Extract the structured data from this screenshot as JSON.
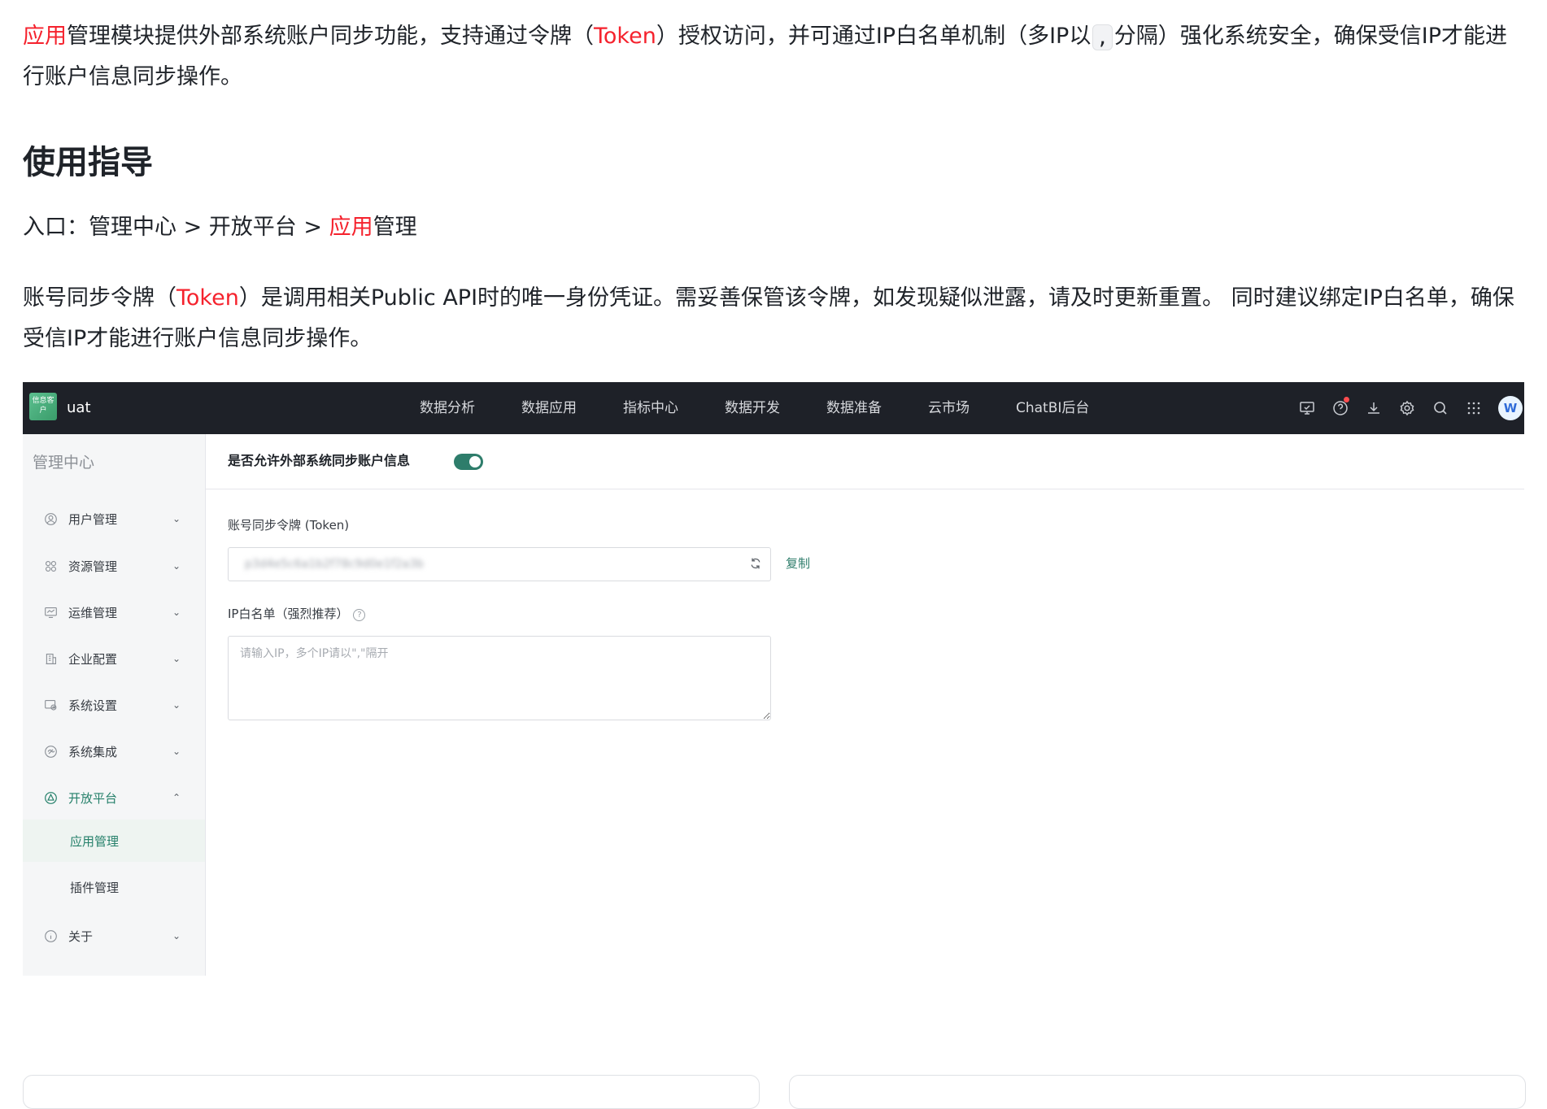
{
  "doc": {
    "intro": {
      "part1_red": "应用",
      "part2": "管理模块提供外部系统账户同步功能，支持通过令牌（",
      "part3_red": "Token",
      "part4": "）授权访问，并可通过IP白名单机制（多IP以",
      "code": ",",
      "part5": "分隔）强化系统安全，确保受信IP才能进行账户信息同步操作。"
    },
    "heading": "使用指导",
    "entry": {
      "prefix": "入口：管理中心 > 开放平台 > ",
      "red": "应用",
      "suffix": "管理"
    },
    "token_para": {
      "part1": "账号同步令牌（",
      "red": "Token",
      "part2": "）是调用相关Public API时的唯一身份凭证。需妥善保管该令牌，如发现疑似泄露，请及时更新重置。 同时建议绑定IP白名单，确保受信IP才能进行账户信息同步操作。"
    }
  },
  "screenshot": {
    "brand": "uat",
    "logo_text": "信息客户",
    "nav": [
      "数据分析",
      "数据应用",
      "指标中心",
      "数据开发",
      "数据准备",
      "云市场",
      "ChatBI后台"
    ],
    "top_icons": [
      "monitor-icon",
      "help-icon",
      "download-icon",
      "settings-icon",
      "search-icon",
      "apps-grid-icon",
      "avatar"
    ],
    "avatar_text": "W",
    "sidebar": {
      "title": "管理中心",
      "items": [
        {
          "label": "用户管理",
          "icon": "user-icon",
          "chevron": "down"
        },
        {
          "label": "资源管理",
          "icon": "resource-icon",
          "chevron": "down"
        },
        {
          "label": "运维管理",
          "icon": "ops-icon",
          "chevron": "down"
        },
        {
          "label": "企业配置",
          "icon": "building-icon",
          "chevron": "down"
        },
        {
          "label": "系统设置",
          "icon": "system-settings-icon",
          "chevron": "down"
        },
        {
          "label": "系统集成",
          "icon": "integration-icon",
          "chevron": "down"
        },
        {
          "label": "开放平台",
          "icon": "open-platform-icon",
          "chevron": "up"
        },
        {
          "label": "关于",
          "icon": "info-icon",
          "chevron": "down"
        }
      ],
      "sub_items": [
        "应用管理",
        "插件管理"
      ]
    },
    "main": {
      "switch_label": "是否允许外部系统同步账户信息",
      "switch_on": true,
      "token_label": "账号同步令牌 (Token)",
      "token_value": "p3d4e5c6a1b2f78c9d0e1f2a3b",
      "copy_label": "复制",
      "ip_label": "IP白名单（强烈推荐）",
      "ip_placeholder": "请输入IP，多个IP请以\",\"隔开"
    },
    "colors": {
      "accent": "#2e7d6b",
      "topbar": "#1e2128",
      "highlight_red": "#f5222d"
    }
  }
}
